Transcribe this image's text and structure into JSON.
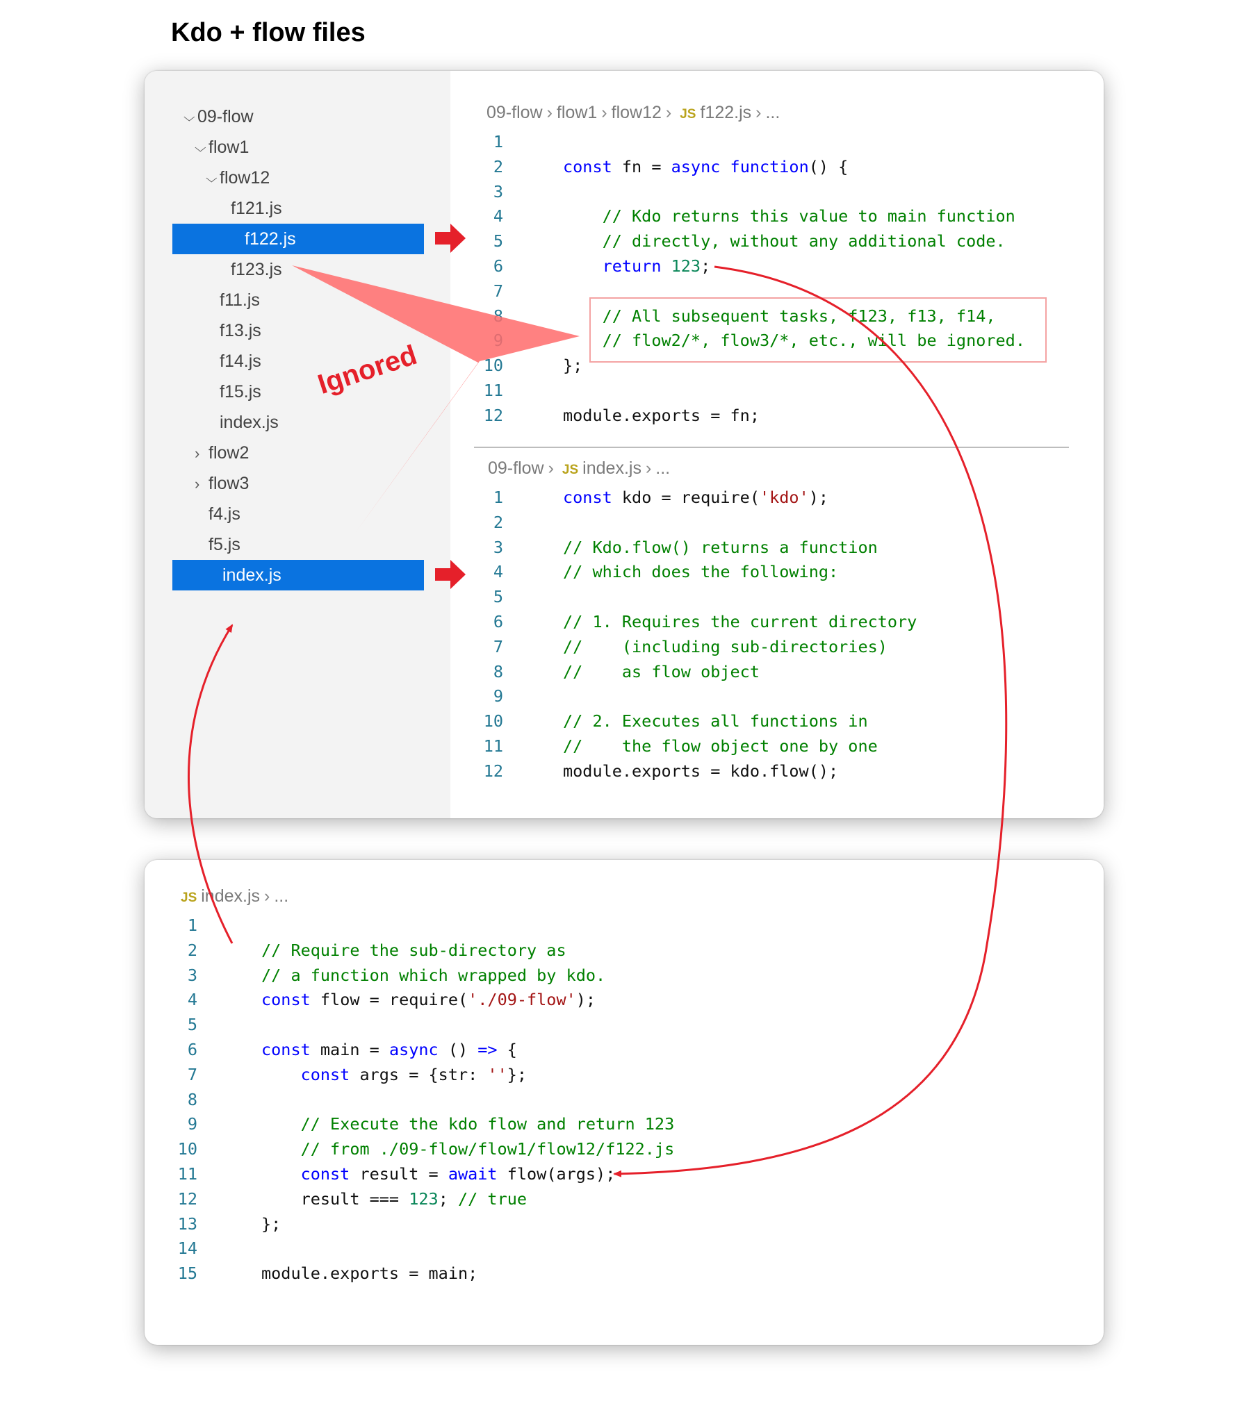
{
  "title": "Kdo + flow files",
  "explorer": {
    "items": [
      {
        "label": "09-flow",
        "chevron": "down"
      },
      {
        "label": "flow1",
        "chevron": "down"
      },
      {
        "label": "flow12",
        "chevron": "down"
      },
      {
        "label": "f121.js",
        "chevron": ""
      },
      {
        "label": "f122.js",
        "chevron": "",
        "selected": true
      },
      {
        "label": "f123.js",
        "chevron": ""
      },
      {
        "label": "f11.js",
        "chevron": ""
      },
      {
        "label": "f13.js",
        "chevron": ""
      },
      {
        "label": "f14.js",
        "chevron": ""
      },
      {
        "label": "f15.js",
        "chevron": ""
      },
      {
        "label": "index.js",
        "chevron": ""
      },
      {
        "label": "flow2",
        "chevron": "right"
      },
      {
        "label": "flow3",
        "chevron": "right"
      },
      {
        "label": "f4.js",
        "chevron": ""
      },
      {
        "label": "f5.js",
        "chevron": ""
      },
      {
        "label": "index.js",
        "chevron": "",
        "selected": true
      }
    ]
  },
  "editor1": {
    "breadcrumb": [
      "09-flow",
      "flow1",
      "flow12",
      "f122.js",
      "..."
    ],
    "js_tag": "JS",
    "lines": [
      [],
      [
        [
          "k",
          "const"
        ],
        [
          "p",
          " fn = "
        ],
        [
          "k",
          "async"
        ],
        [
          "p",
          " "
        ],
        [
          "k",
          "function"
        ],
        [
          "p",
          "() {"
        ]
      ],
      [],
      [
        [
          "p",
          "    "
        ],
        [
          "c",
          "// Kdo returns this value to main function"
        ]
      ],
      [
        [
          "p",
          "    "
        ],
        [
          "c",
          "// directly, without any additional code."
        ]
      ],
      [
        [
          "p",
          "    "
        ],
        [
          "k",
          "return"
        ],
        [
          "p",
          " "
        ],
        [
          "n",
          "123"
        ],
        [
          "p",
          ";"
        ]
      ],
      [],
      [
        [
          "p",
          "    "
        ],
        [
          "c",
          "// All subsequent tasks, f123, f13, f14,"
        ]
      ],
      [
        [
          "p",
          "    "
        ],
        [
          "c",
          "// flow2/*, flow3/*, etc., will be ignored."
        ]
      ],
      [
        [
          "p",
          "};"
        ]
      ],
      [],
      [
        [
          "p",
          "module.exports = fn;"
        ]
      ]
    ]
  },
  "editor2": {
    "breadcrumb": [
      "09-flow",
      "index.js",
      "..."
    ],
    "js_tag": "JS",
    "lines": [
      [
        [
          "k",
          "const"
        ],
        [
          "p",
          " kdo = require("
        ],
        [
          "s",
          "'kdo'"
        ],
        [
          "p",
          ");"
        ]
      ],
      [],
      [
        [
          "c",
          "// Kdo.flow() returns a function"
        ]
      ],
      [
        [
          "c",
          "// which does the following:"
        ]
      ],
      [],
      [
        [
          "c",
          "// 1. Requires the current directory"
        ]
      ],
      [
        [
          "c",
          "//    (including sub-directories)"
        ]
      ],
      [
        [
          "c",
          "//    as flow object"
        ]
      ],
      [],
      [
        [
          "c",
          "// 2. Executes all functions in"
        ]
      ],
      [
        [
          "c",
          "//    the flow object one by one"
        ]
      ],
      [
        [
          "p",
          "module.exports = kdo.flow();"
        ]
      ]
    ]
  },
  "editor3": {
    "breadcrumb": [
      "index.js",
      "..."
    ],
    "js_tag": "JS",
    "lines": [
      [],
      [
        [
          "c",
          "// Require the sub-directory as"
        ]
      ],
      [
        [
          "c",
          "// a function which wrapped by kdo."
        ]
      ],
      [
        [
          "k",
          "const"
        ],
        [
          "p",
          " flow = require("
        ],
        [
          "s",
          "'./09-flow'"
        ],
        [
          "p",
          ");"
        ]
      ],
      [],
      [
        [
          "k",
          "const"
        ],
        [
          "p",
          " main = "
        ],
        [
          "k",
          "async"
        ],
        [
          "p",
          " () "
        ],
        [
          "k",
          "=>"
        ],
        [
          "p",
          " {"
        ]
      ],
      [
        [
          "p",
          "    "
        ],
        [
          "k",
          "const"
        ],
        [
          "p",
          " args = {str: "
        ],
        [
          "s",
          "''"
        ],
        [
          "p",
          "};"
        ]
      ],
      [],
      [
        [
          "p",
          "    "
        ],
        [
          "c",
          "// Execute the kdo flow and return 123"
        ]
      ],
      [
        [
          "p",
          "    "
        ],
        [
          "c",
          "// from ./09-flow/flow1/flow12/f122.js"
        ]
      ],
      [
        [
          "p",
          "    "
        ],
        [
          "k",
          "const"
        ],
        [
          "p",
          " result = "
        ],
        [
          "k",
          "await"
        ],
        [
          "p",
          " flow(args);"
        ]
      ],
      [
        [
          "p",
          "    result === "
        ],
        [
          "n",
          "123"
        ],
        [
          "p",
          "; "
        ],
        [
          "c",
          "// true"
        ]
      ],
      [
        [
          "p",
          "};"
        ]
      ],
      [],
      [
        [
          "p",
          "module.exports = main;"
        ]
      ]
    ]
  },
  "annotation": {
    "ignored_label": "Ignored",
    "arrow_color": "#e5202a",
    "fan_color": "#ff6b6b"
  },
  "colors": {
    "selection": "#0a73e0",
    "keyword": "#0000ff",
    "comment": "#008000",
    "string": "#a31515",
    "number": "#098658",
    "line_number": "#237893"
  }
}
